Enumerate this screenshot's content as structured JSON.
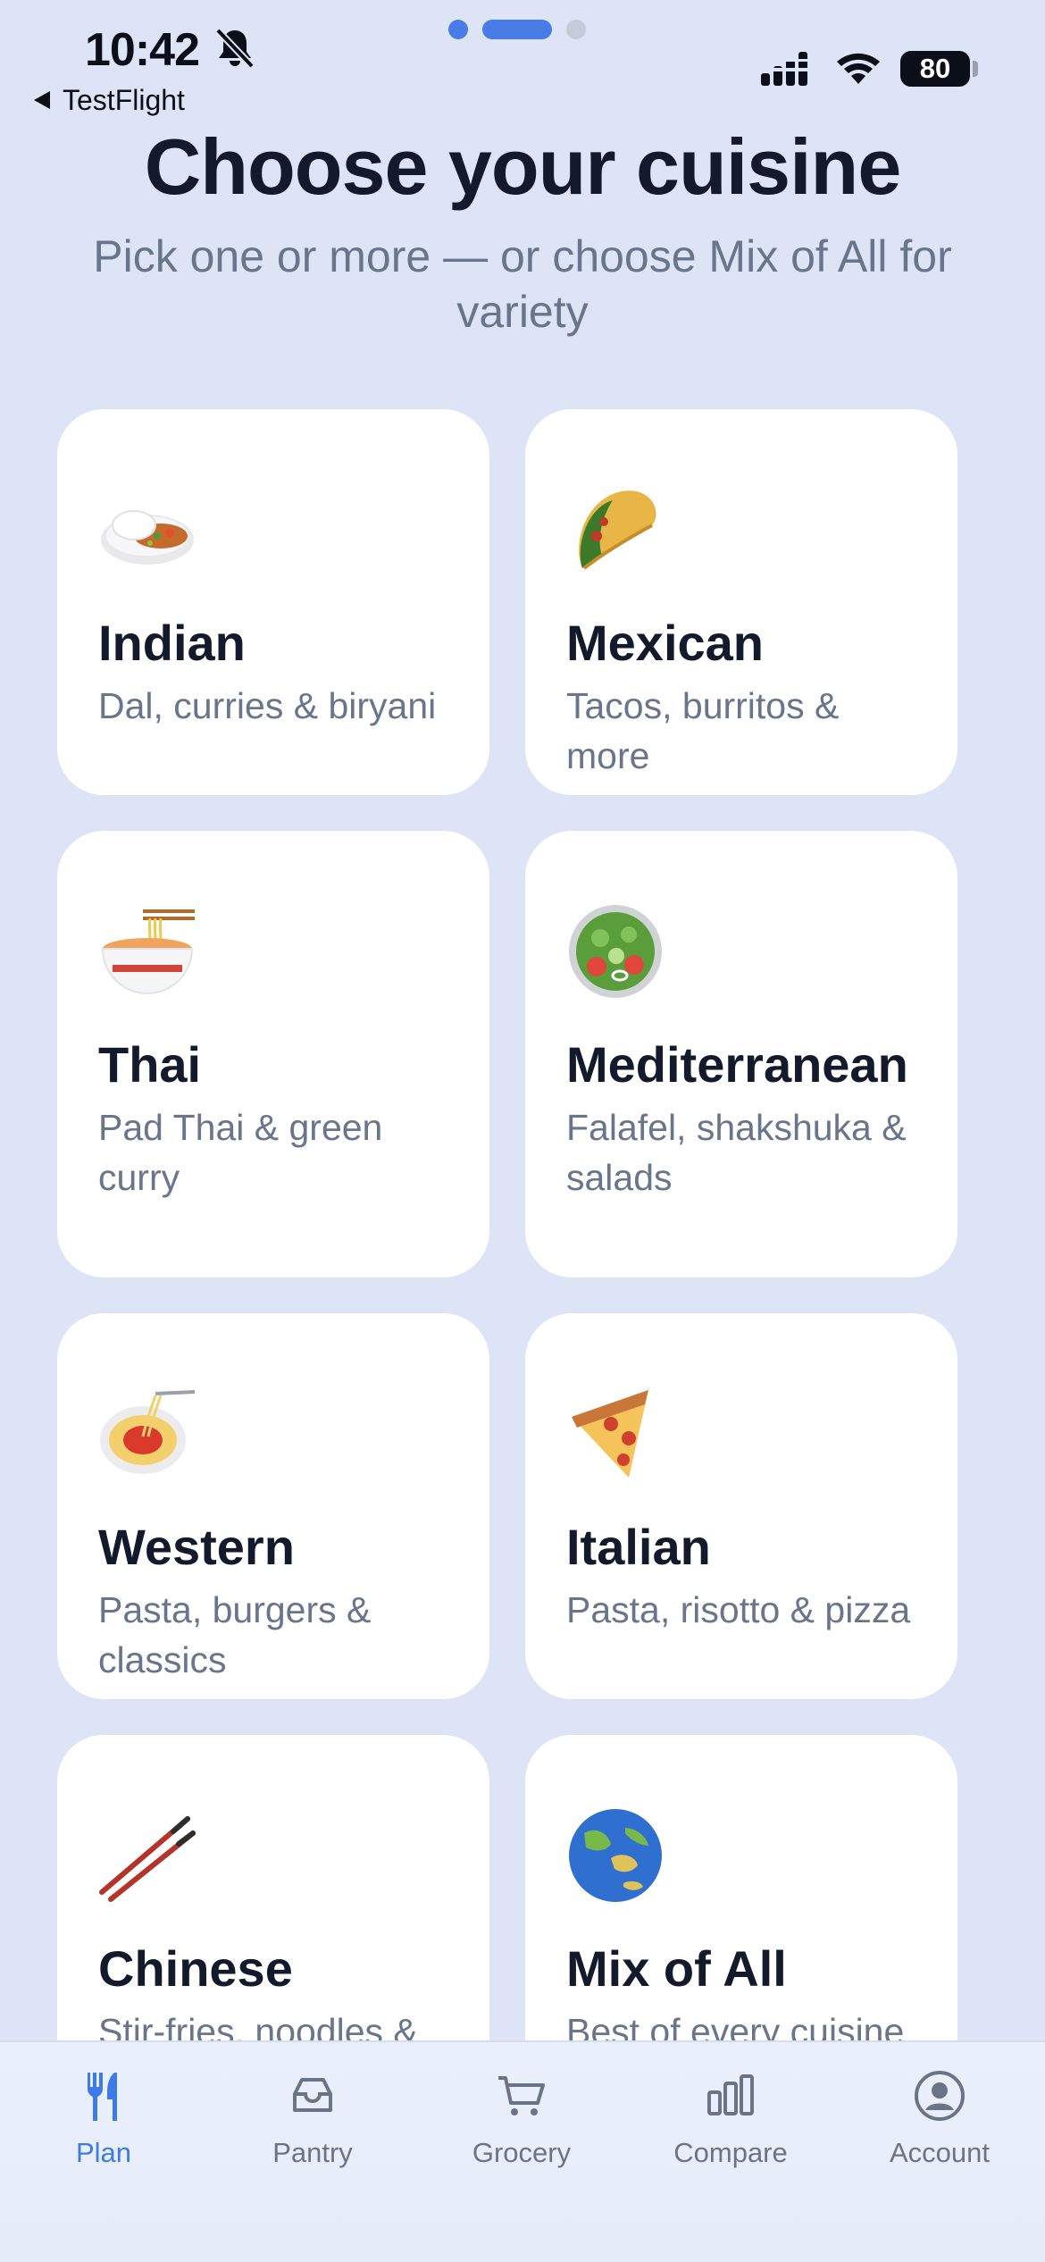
{
  "status_bar": {
    "time": "10:42",
    "back_label": "TestFlight",
    "battery": "80"
  },
  "header": {
    "title": "Choose your cuisine",
    "subtitle": "Pick one or more — or choose Mix of All for variety"
  },
  "cuisines": [
    {
      "name": "Indian",
      "description": "Dal, curries & biryani",
      "icon": "curry-rice-icon"
    },
    {
      "name": "Mexican",
      "description": "Tacos, burritos & more",
      "icon": "taco-icon"
    },
    {
      "name": "Thai",
      "description": "Pad Thai & green curry",
      "icon": "noodle-bowl-icon"
    },
    {
      "name": "Mediterranean",
      "description": "Falafel, shakshuka & salads",
      "icon": "salad-icon"
    },
    {
      "name": "Western",
      "description": "Pasta, burgers & classics",
      "icon": "spaghetti-icon"
    },
    {
      "name": "Italian",
      "description": "Pasta, risotto & pizza",
      "icon": "pizza-icon"
    },
    {
      "name": "Chinese",
      "description": "Stir-fries, noodles & dumplings",
      "icon": "chopsticks-icon"
    },
    {
      "name": "Mix of All",
      "description": "Best of every cuisine",
      "icon": "globe-icon"
    }
  ],
  "tabs": [
    {
      "label": "Plan",
      "icon": "fork-knife-icon",
      "active": true
    },
    {
      "label": "Pantry",
      "icon": "tray-icon",
      "active": false
    },
    {
      "label": "Grocery",
      "icon": "cart-icon",
      "active": false
    },
    {
      "label": "Compare",
      "icon": "bar-chart-icon",
      "active": false
    },
    {
      "label": "Account",
      "icon": "account-icon",
      "active": false
    }
  ],
  "colors": {
    "background": "#dde4f6",
    "card": "#ffffff",
    "accent": "#3f7be6",
    "title_text": "#131a2b",
    "secondary_text": "#68758a"
  }
}
